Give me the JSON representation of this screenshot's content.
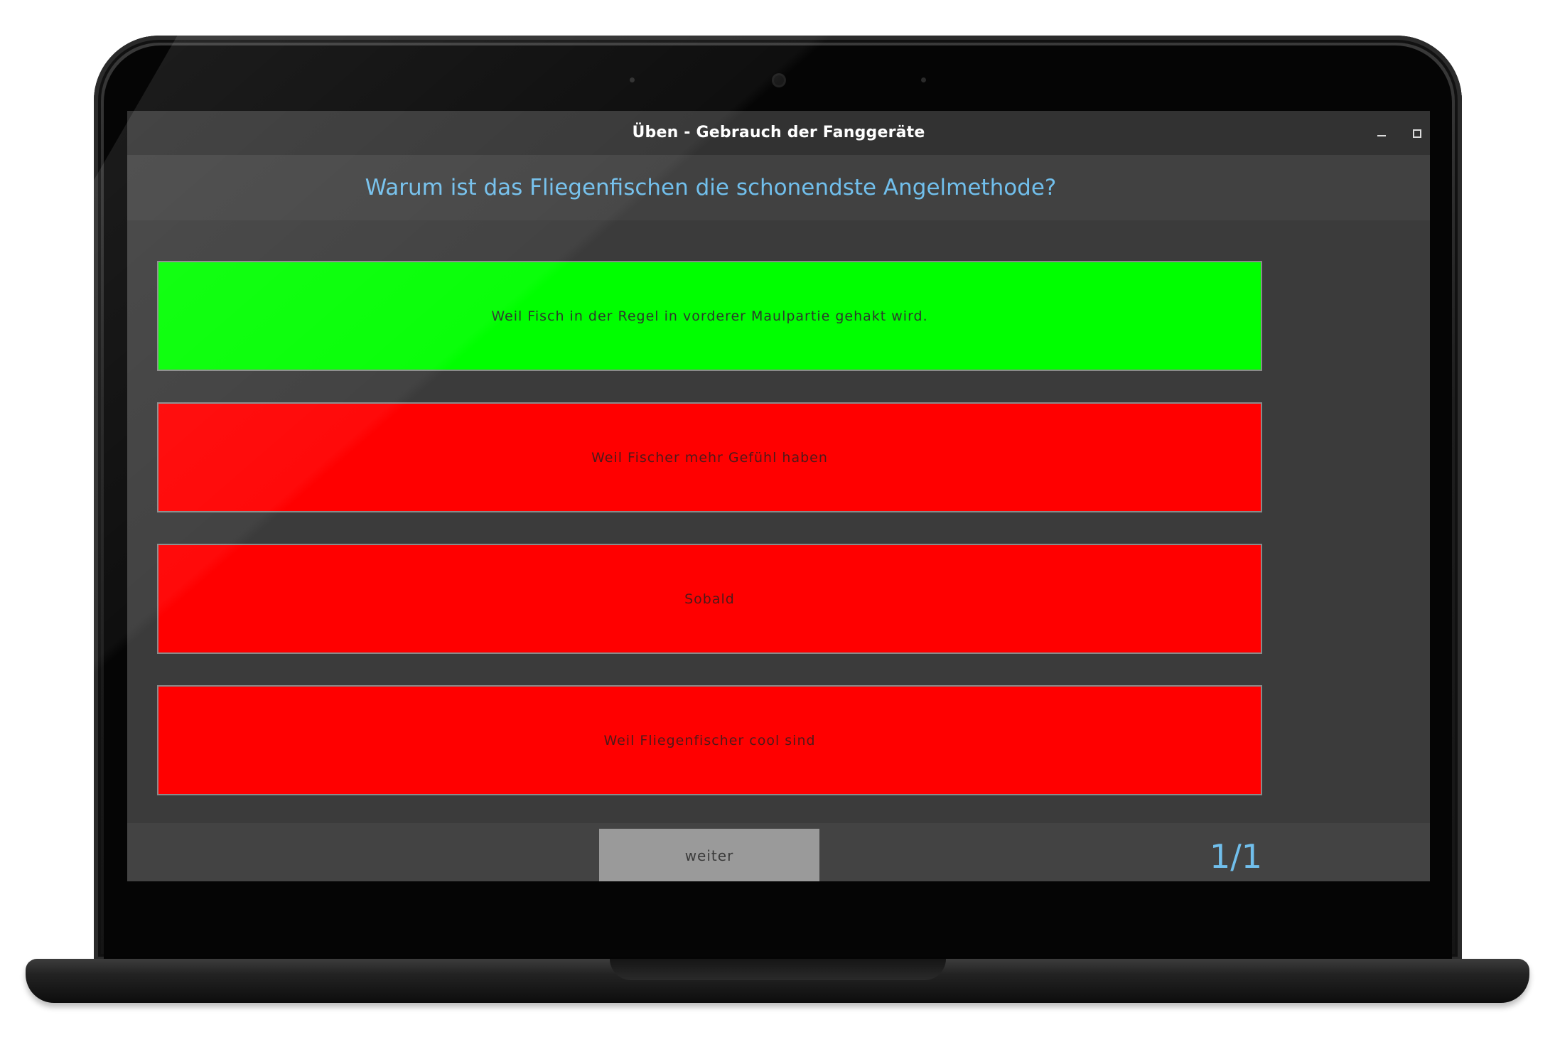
{
  "window": {
    "title": "Üben - Gebrauch der Fanggeräte",
    "controls": [
      "minimize-icon",
      "maximize-icon"
    ]
  },
  "question": {
    "text": "Warum ist das Fliegenfischen die schonendste Angelmethode?"
  },
  "answers": [
    {
      "label": "Weil Fisch in der Regel in vorderer Maulpartie gehakt wird.",
      "state": "correct",
      "color": "#00ff00"
    },
    {
      "label": "Weil Fischer mehr Gefühl haben",
      "state": "wrong",
      "color": "#ff0000"
    },
    {
      "label": "Sobald",
      "state": "wrong",
      "color": "#ff0000"
    },
    {
      "label": "Weil Fliegenfischer cool sind",
      "state": "wrong",
      "color": "#ff0000"
    }
  ],
  "footer": {
    "next_label": "weiter",
    "progress": "1/1"
  },
  "colors": {
    "accent_text": "#71bfec",
    "background": "#3b3b3b",
    "correct": "#00ff00",
    "wrong": "#ff0000",
    "button": "#9a9a9a"
  }
}
